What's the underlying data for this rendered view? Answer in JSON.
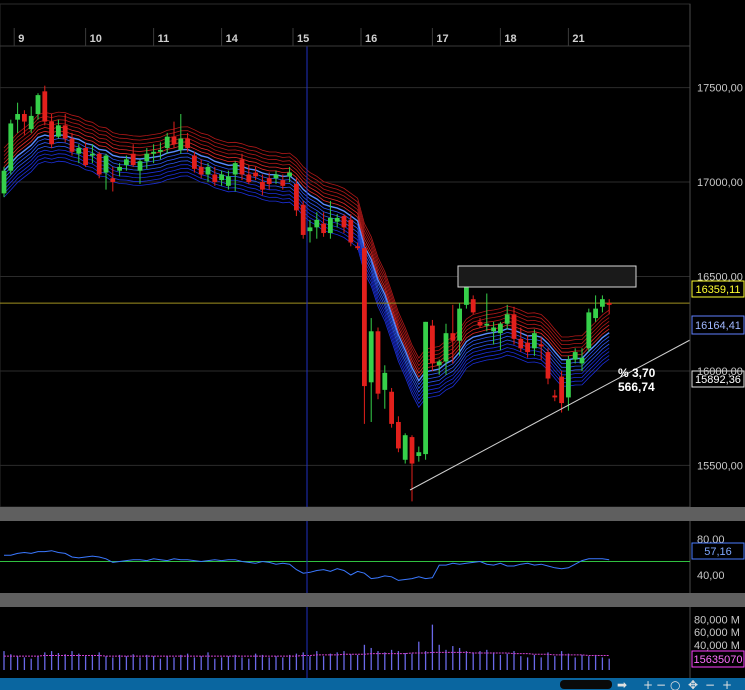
{
  "chart_data": [
    {
      "type": "candlestick",
      "x_tick_labels": [
        "9",
        "10",
        "11",
        "14",
        "15",
        "16",
        "17",
        "18",
        "21"
      ],
      "y_tick_labels": [
        "17500,00",
        "17000,00",
        "16500,00",
        "16000,00",
        "15500,00"
      ],
      "ylim": [
        15280,
        17720
      ],
      "last_price_label": "16359,11",
      "band_price_label": "16164,41",
      "lower_price_label": "15892,36",
      "annotation_percent": "% 3,70",
      "annotation_points": "566,74",
      "candles": [
        [
          16940,
          17080,
          16920,
          17060
        ],
        [
          17060,
          17330,
          17040,
          17310
        ],
        [
          17330,
          17420,
          17260,
          17360
        ],
        [
          17360,
          17380,
          17250,
          17320
        ],
        [
          17280,
          17400,
          17260,
          17350
        ],
        [
          17360,
          17470,
          17330,
          17460
        ],
        [
          17480,
          17510,
          17300,
          17320
        ],
        [
          17320,
          17360,
          17180,
          17200
        ],
        [
          17240,
          17330,
          17230,
          17300
        ],
        [
          17300,
          17360,
          17210,
          17230
        ],
        [
          17230,
          17260,
          17140,
          17160
        ],
        [
          17150,
          17200,
          17100,
          17180
        ],
        [
          17180,
          17210,
          17080,
          17090
        ],
        [
          17140,
          17200,
          17100,
          17150
        ],
        [
          17150,
          17160,
          17020,
          17040
        ],
        [
          17050,
          17150,
          16960,
          17140
        ],
        [
          17020,
          17080,
          16950,
          17000
        ],
        [
          17060,
          17100,
          17030,
          17080
        ],
        [
          17090,
          17140,
          17060,
          17120
        ],
        [
          17150,
          17200,
          17080,
          17090
        ],
        [
          17060,
          17120,
          16990,
          17110
        ],
        [
          17110,
          17180,
          17070,
          17150
        ],
        [
          17150,
          17200,
          17100,
          17160
        ],
        [
          17160,
          17210,
          17120,
          17170
        ],
        [
          17180,
          17260,
          17150,
          17240
        ],
        [
          17240,
          17320,
          17180,
          17200
        ],
        [
          17170,
          17360,
          17150,
          17230
        ],
        [
          17230,
          17260,
          17160,
          17180
        ],
        [
          17140,
          17160,
          17050,
          17070
        ],
        [
          17080,
          17120,
          17020,
          17040
        ],
        [
          17040,
          17100,
          17000,
          17080
        ],
        [
          17040,
          17080,
          16980,
          17000
        ],
        [
          17010,
          17060,
          16980,
          17040
        ],
        [
          16980,
          17060,
          16960,
          17030
        ],
        [
          17040,
          17110,
          16950,
          17100
        ],
        [
          17120,
          17150,
          17010,
          17040
        ],
        [
          17040,
          17090,
          16990,
          17000
        ],
        [
          17050,
          17080,
          17010,
          17030
        ],
        [
          17000,
          17040,
          16930,
          16960
        ],
        [
          17020,
          17050,
          16960,
          16990
        ],
        [
          17020,
          17060,
          16990,
          17040
        ],
        [
          17010,
          17040,
          16960,
          16980
        ],
        [
          17030,
          17080,
          17000,
          17050
        ],
        [
          16990,
          17020,
          16820,
          16850
        ],
        [
          16880,
          16900,
          16700,
          16720
        ],
        [
          16740,
          16800,
          16680,
          16760
        ],
        [
          16760,
          16840,
          16700,
          16800
        ],
        [
          16780,
          16840,
          16710,
          16730
        ],
        [
          16730,
          16900,
          16700,
          16810
        ],
        [
          16790,
          16830,
          16760,
          16810
        ],
        [
          16820,
          16830,
          16730,
          16760
        ],
        [
          16800,
          16830,
          16660,
          16680
        ],
        [
          16660,
          16680,
          16640,
          16650
        ],
        [
          16650,
          16680,
          15720,
          15920
        ],
        [
          15940,
          16280,
          15730,
          16210
        ],
        [
          16210,
          16230,
          15850,
          15880
        ],
        [
          15900,
          16030,
          15800,
          15990
        ],
        [
          15890,
          15910,
          15700,
          15720
        ],
        [
          15730,
          15760,
          15570,
          15590
        ],
        [
          15530,
          15670,
          15510,
          15660
        ],
        [
          15650,
          15660,
          15310,
          15510
        ],
        [
          15550,
          15600,
          15520,
          15570
        ],
        [
          15560,
          16260,
          15530,
          16260
        ],
        [
          16240,
          16270,
          16000,
          16040
        ],
        [
          16030,
          16060,
          15980,
          16050
        ],
        [
          16050,
          16250,
          15980,
          16200
        ],
        [
          16200,
          16350,
          16040,
          16160
        ],
        [
          16160,
          16360,
          16080,
          16330
        ],
        [
          16350,
          16490,
          16330,
          16460
        ],
        [
          16380,
          16400,
          16300,
          16310
        ],
        [
          16260,
          16280,
          16230,
          16240
        ],
        [
          16240,
          16410,
          16210,
          16250
        ],
        [
          16210,
          16260,
          16140,
          16230
        ],
        [
          16200,
          16260,
          16110,
          16250
        ],
        [
          16250,
          16350,
          16220,
          16300
        ],
        [
          16300,
          16340,
          16140,
          16170
        ],
        [
          16170,
          16230,
          16100,
          16120
        ],
        [
          16150,
          16190,
          16070,
          16100
        ],
        [
          16120,
          16220,
          16080,
          16200
        ],
        [
          16140,
          16180,
          16060,
          16130
        ],
        [
          16100,
          16120,
          15930,
          15960
        ],
        [
          15870,
          15900,
          15840,
          15860
        ],
        [
          15970,
          16000,
          15780,
          15830
        ],
        [
          15860,
          16080,
          15790,
          16060
        ],
        [
          16060,
          16120,
          16040,
          16100
        ],
        [
          16040,
          16120,
          16000,
          16070
        ],
        [
          16120,
          16330,
          16100,
          16310
        ],
        [
          16280,
          16400,
          16260,
          16330
        ],
        [
          16340,
          16400,
          16310,
          16380
        ],
        [
          16360,
          16380,
          16300,
          16350
        ]
      ]
    },
    {
      "type": "line",
      "y_tick_labels": [
        "80,00",
        "40,00"
      ],
      "ylim": [
        20,
        100
      ],
      "last_value_label": "57,16",
      "reference_level": 55,
      "values": [
        62,
        62,
        64,
        65,
        64,
        66,
        66,
        67,
        65,
        64,
        60,
        59,
        60,
        61,
        60,
        58,
        54,
        55,
        56,
        57,
        57,
        56,
        58,
        57,
        56,
        58,
        57,
        57,
        56,
        55,
        56,
        57,
        56,
        57,
        57,
        55,
        54,
        53,
        55,
        54,
        52,
        53,
        52,
        46,
        42,
        43,
        45,
        46,
        44,
        47,
        45,
        40,
        44,
        42,
        36,
        37,
        39,
        38,
        34,
        35,
        36,
        38,
        36,
        37,
        51,
        51,
        53,
        52,
        53,
        54,
        55,
        52,
        51,
        53,
        50,
        50,
        52,
        53,
        51,
        52,
        50,
        48,
        47,
        48,
        52,
        56,
        58,
        58,
        58,
        57
      ]
    },
    {
      "type": "bar",
      "y_tick_labels": [
        "80,000 M",
        "60,000 M",
        "40,000 M"
      ],
      "ylim": [
        0,
        100
      ],
      "last_value_label": "15635070",
      "values": [
        30,
        25,
        22,
        20,
        18,
        22,
        28,
        30,
        27,
        25,
        30,
        26,
        22,
        24,
        28,
        22,
        20,
        24,
        22,
        25,
        20,
        24,
        22,
        18,
        22,
        20,
        24,
        26,
        20,
        22,
        28,
        18,
        20,
        22,
        24,
        20,
        18,
        26,
        24,
        20,
        22,
        20,
        24,
        26,
        28,
        22,
        30,
        22,
        26,
        28,
        30,
        25,
        24,
        40,
        35,
        30,
        28,
        32,
        30,
        27,
        26,
        45,
        30,
        72,
        40,
        32,
        38,
        35,
        30,
        28,
        30,
        32,
        28,
        24,
        26,
        30,
        22,
        20,
        24,
        20,
        28,
        22,
        30,
        26,
        20,
        24,
        22,
        24,
        20,
        18
      ],
      "average": [
        22,
        22,
        22,
        22,
        22,
        22,
        23,
        23,
        23,
        23,
        23,
        23,
        23,
        23,
        23,
        22,
        22,
        22,
        22,
        22,
        22,
        22,
        22,
        22,
        22,
        22,
        22,
        22,
        22,
        22,
        22,
        22,
        22,
        22,
        22,
        22,
        22,
        22,
        22,
        22,
        22,
        22,
        22,
        22,
        23,
        23,
        24,
        24,
        24,
        24,
        25,
        25,
        25,
        25,
        26,
        26,
        26,
        26,
        26,
        26,
        27,
        27,
        27,
        28,
        28,
        28,
        28,
        28,
        28,
        27,
        27,
        27,
        27,
        27,
        27,
        26,
        26,
        26,
        25,
        25,
        25,
        24,
        24,
        24,
        24,
        24,
        23,
        23,
        23,
        23
      ]
    }
  ],
  "colors": {
    "background": "#000000",
    "bull": "#36d04a",
    "bear": "#e2201c",
    "grid": "#2b2b2b",
    "axis_text": "#c8c8c8",
    "price_line": "#a09020",
    "price_box": "#ffff30",
    "band_box": "#6080ff",
    "rsi_line": "#3a78ff",
    "rsi_ref": "#30c040",
    "rsi_box": "#4a7cff",
    "volume_bar": "#6a68e8",
    "volume_avg": "#d040d0",
    "volume_box": "#ff40ff",
    "cursor": "#2030c0",
    "separator": "#5f5f5f",
    "status_bar": "#0a66a0"
  },
  "icons": {
    "scroll_right": "arrow-right-icon",
    "zoom_in": "plus-icon",
    "zoom_out": "minus-icon",
    "zoom_reset": "circle-icon",
    "drag": "move-icon"
  }
}
